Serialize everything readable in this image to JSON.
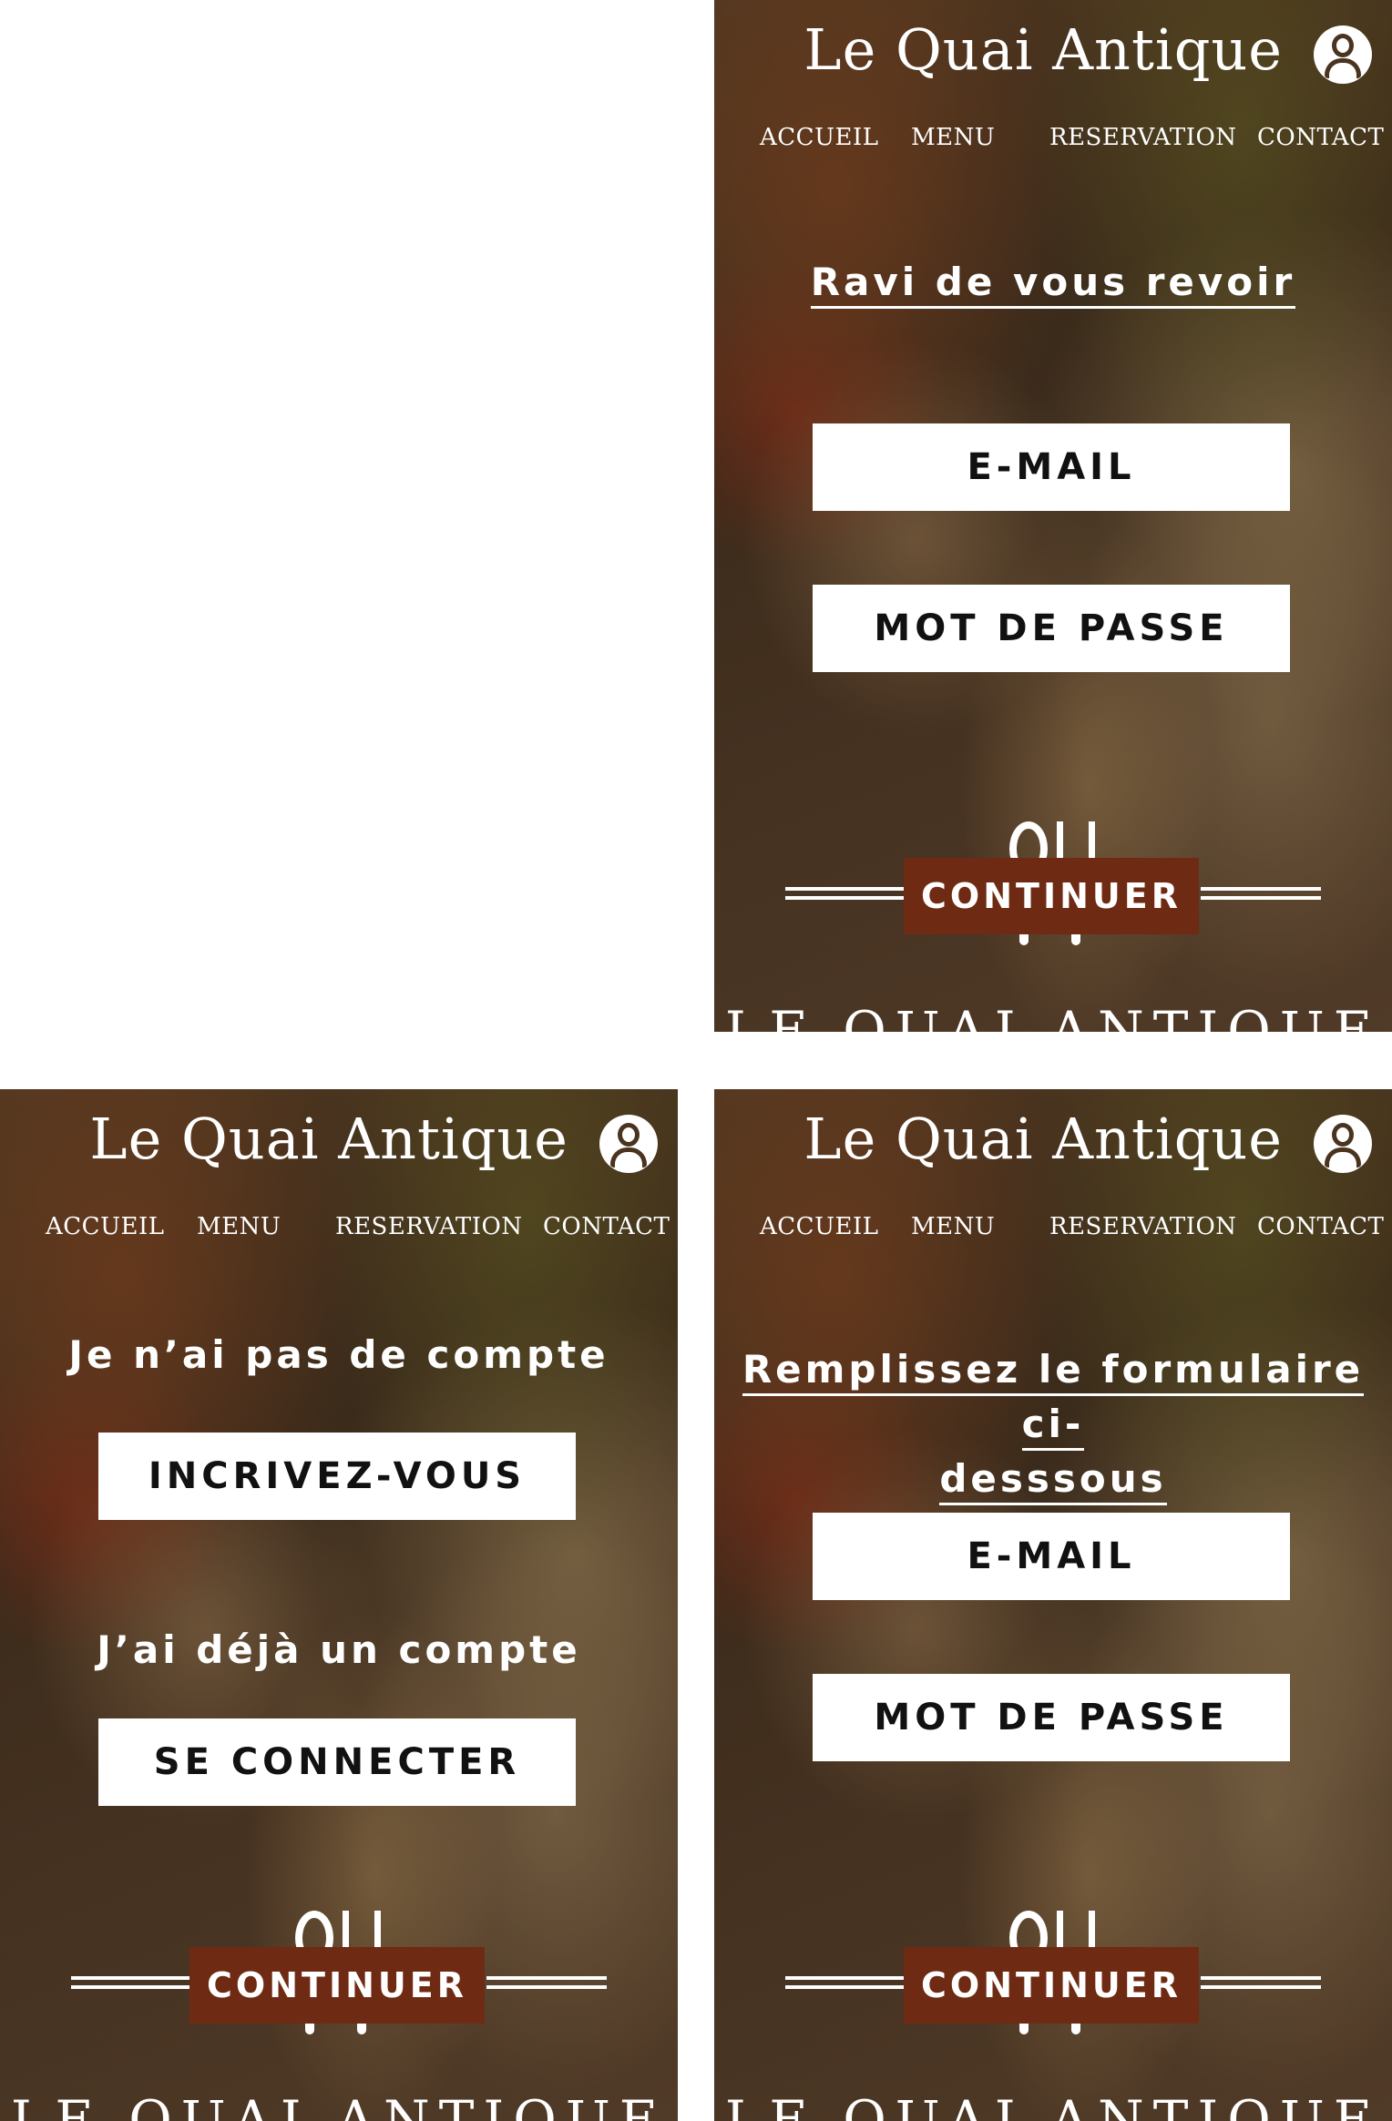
{
  "brand": "Le Quai Antique",
  "nav": [
    "ACCUEIL",
    "MENU",
    "RESERVATION",
    "CONTACT"
  ],
  "footer": "LE QUAI ANTIQUE",
  "continue_label": "CONTINUER",
  "login": {
    "heading": "Ravi de vous revoir",
    "email_label": "E-MAIL",
    "password_label": "MOT DE PASSE"
  },
  "account": {
    "no_account": "Je n’ai pas de compte",
    "signup_label": "INCRIVEZ-VOUS",
    "have_account": "J’ai déjà un compte",
    "signin_label": "SE CONNECTER"
  },
  "signup_form": {
    "heading_line1": "Remplissez le formulaire ci-",
    "heading_line2": "desssous",
    "email_label": "E-MAIL",
    "password_label": "MOT DE PASSE"
  }
}
